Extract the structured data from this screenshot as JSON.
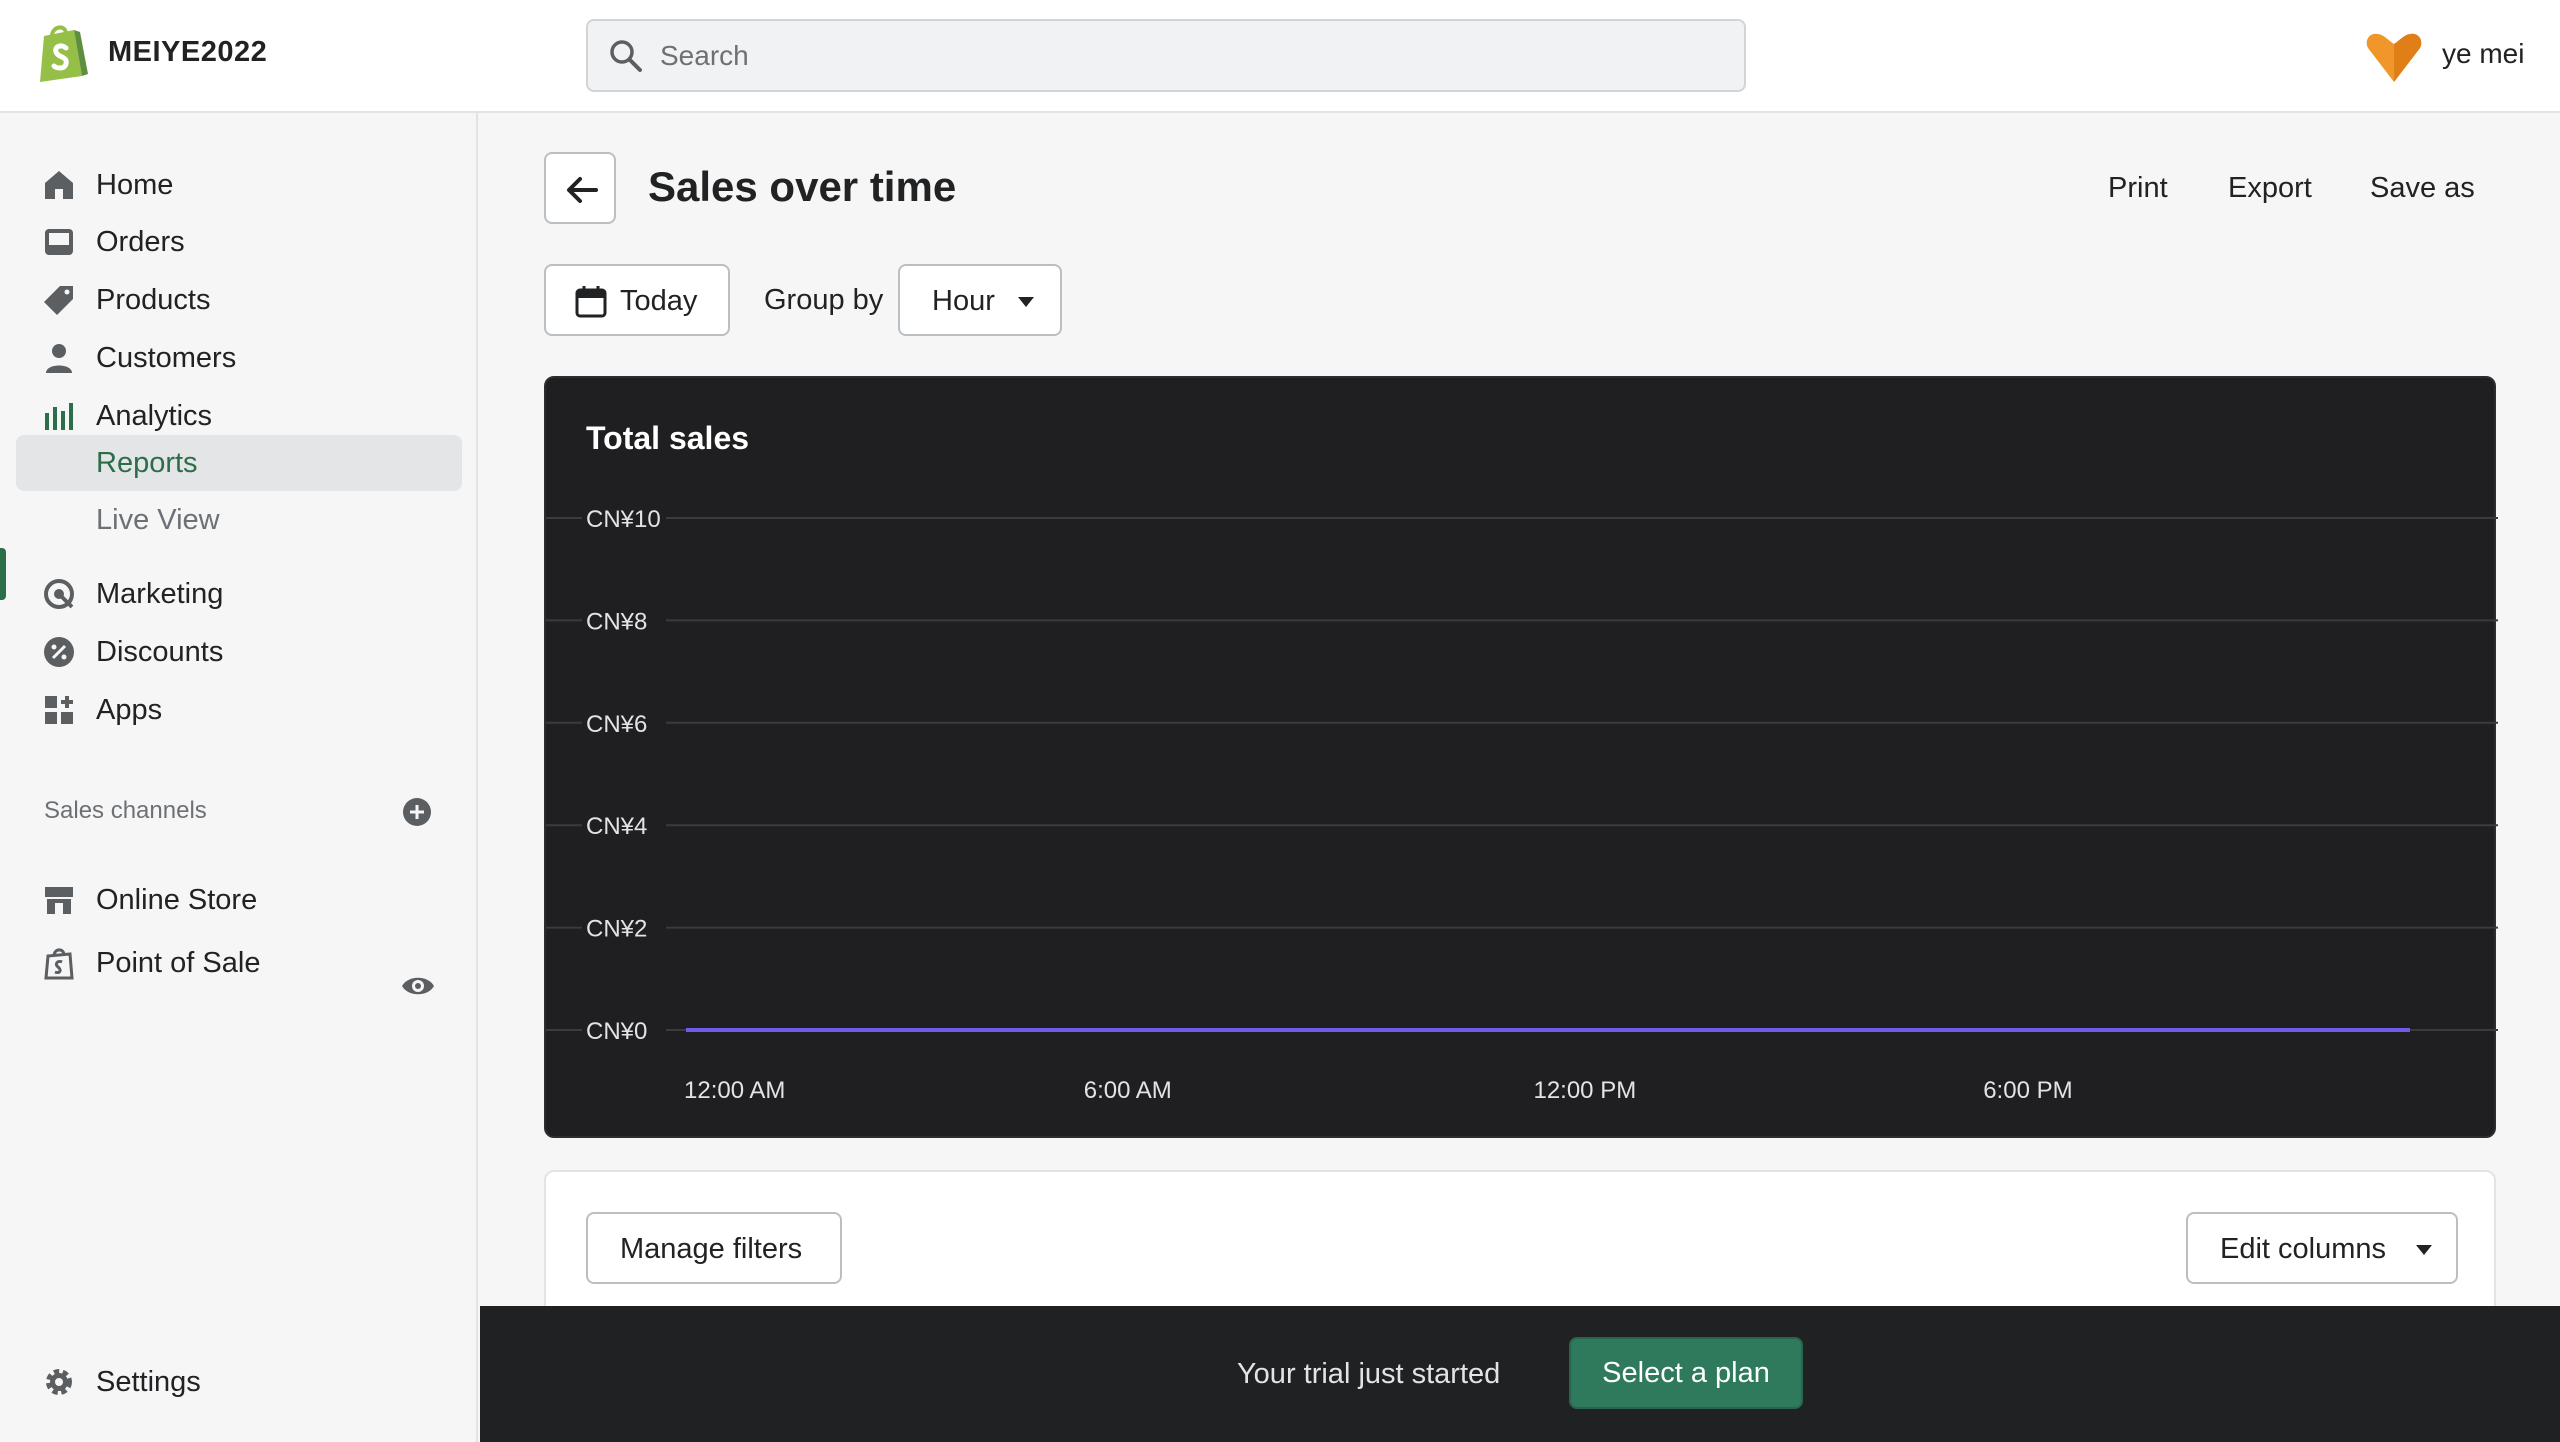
{
  "topbar": {
    "store_name": "MEIYE2022",
    "search_placeholder": "Search",
    "user_name": "ye mei"
  },
  "sidebar": {
    "items": [
      {
        "label": "Home",
        "icon": "home-icon"
      },
      {
        "label": "Orders",
        "icon": "inbox-icon"
      },
      {
        "label": "Products",
        "icon": "tag-icon"
      },
      {
        "label": "Customers",
        "icon": "person-icon"
      },
      {
        "label": "Analytics",
        "icon": "bar-chart-icon"
      },
      {
        "label": "Reports",
        "icon": ""
      },
      {
        "label": "Live View",
        "icon": ""
      },
      {
        "label": "Marketing",
        "icon": "target-icon"
      },
      {
        "label": "Discounts",
        "icon": "discount-icon"
      },
      {
        "label": "Apps",
        "icon": "apps-icon"
      }
    ],
    "channels_title": "Sales channels",
    "channels": [
      {
        "label": "Online Store",
        "icon": "store-icon"
      },
      {
        "label": "Point of Sale",
        "icon": "pos-bag-icon"
      }
    ],
    "settings_label": "Settings"
  },
  "header": {
    "title": "Sales over time",
    "actions": [
      "Print",
      "Export",
      "Save as"
    ]
  },
  "filters": {
    "date_label": "Today",
    "group_by_label": "Group by",
    "group_by_value": "Hour"
  },
  "chart_data": {
    "type": "line",
    "title": "Total sales",
    "x_tick_labels": [
      "12:00 AM",
      "6:00 AM",
      "12:00 PM",
      "6:00 PM"
    ],
    "y_tick_labels": [
      "CN¥10",
      "CN¥8",
      "CN¥6",
      "CN¥4",
      "CN¥2",
      "CN¥0"
    ],
    "ylim": [
      0,
      10
    ],
    "x": [
      0,
      23
    ],
    "series": [
      {
        "values": [
          0,
          0
        ]
      }
    ],
    "grid": true,
    "colors": {
      "line": "#6c5ce7",
      "background": "#1f1f22",
      "grid": "#3a3a3f",
      "text": "#e3e3e3"
    }
  },
  "table": {
    "manage_filters_label": "Manage filters",
    "edit_columns_label": "Edit columns"
  },
  "trial": {
    "text": "Your trial just started",
    "button_label": "Select a plan"
  },
  "colors": {
    "accent": "#2c6e49",
    "primary_button": "#2f7a5c",
    "avatar": "#f0962b"
  }
}
